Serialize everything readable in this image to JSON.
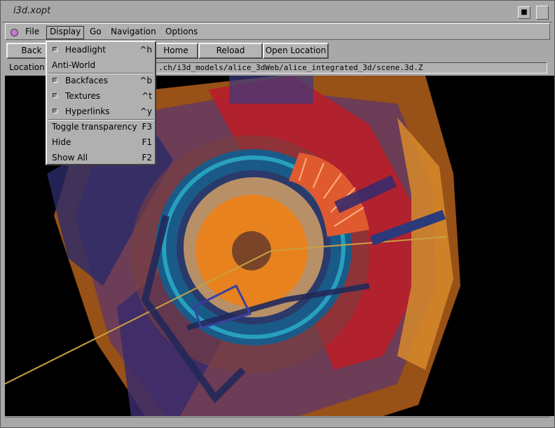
{
  "window": {
    "title": "i3d.xopt"
  },
  "menubar": {
    "items": [
      "File",
      "Display",
      "Go",
      "Navigation",
      "Options"
    ],
    "active": "Display"
  },
  "toolbar": {
    "back": "Back",
    "home": "Home",
    "reload": "Reload",
    "open_location": "Open Location"
  },
  "location": {
    "label": "Location",
    "url": "http://...ch/i3d_models/alice_3dWeb/alice_integrated_3d/scene.3d.Z",
    "visible_url": ".ch/i3d_models/alice_3dWeb/alice_integrated_3d/scene.3d.Z"
  },
  "display_menu": {
    "headlight": {
      "label": "Headlight",
      "accel": "^h"
    },
    "anti_world": {
      "label": "Anti-World"
    },
    "backfaces": {
      "label": "Backfaces",
      "accel": "^b"
    },
    "textures": {
      "label": "Textures",
      "accel": "^t"
    },
    "hyperlinks": {
      "label": "Hyperlinks",
      "accel": "^y"
    },
    "toggle_transparency": {
      "label": "Toggle transparency",
      "accel": "F3"
    },
    "hide": {
      "label": "Hide",
      "accel": "F1"
    },
    "show_all": {
      "label": "Show All",
      "accel": "F2"
    }
  },
  "colors": {
    "chrome": "#a8a8a8",
    "viewport_bg": "#000000",
    "orange": "#e8821e",
    "red": "#a01818",
    "blue": "#1a6a9a",
    "cyan": "#25b0c8"
  },
  "icons": {
    "window_menu": "window-menu-icon",
    "maximize": "maximize-icon",
    "menu_dot": "app-menu-dot-icon"
  }
}
